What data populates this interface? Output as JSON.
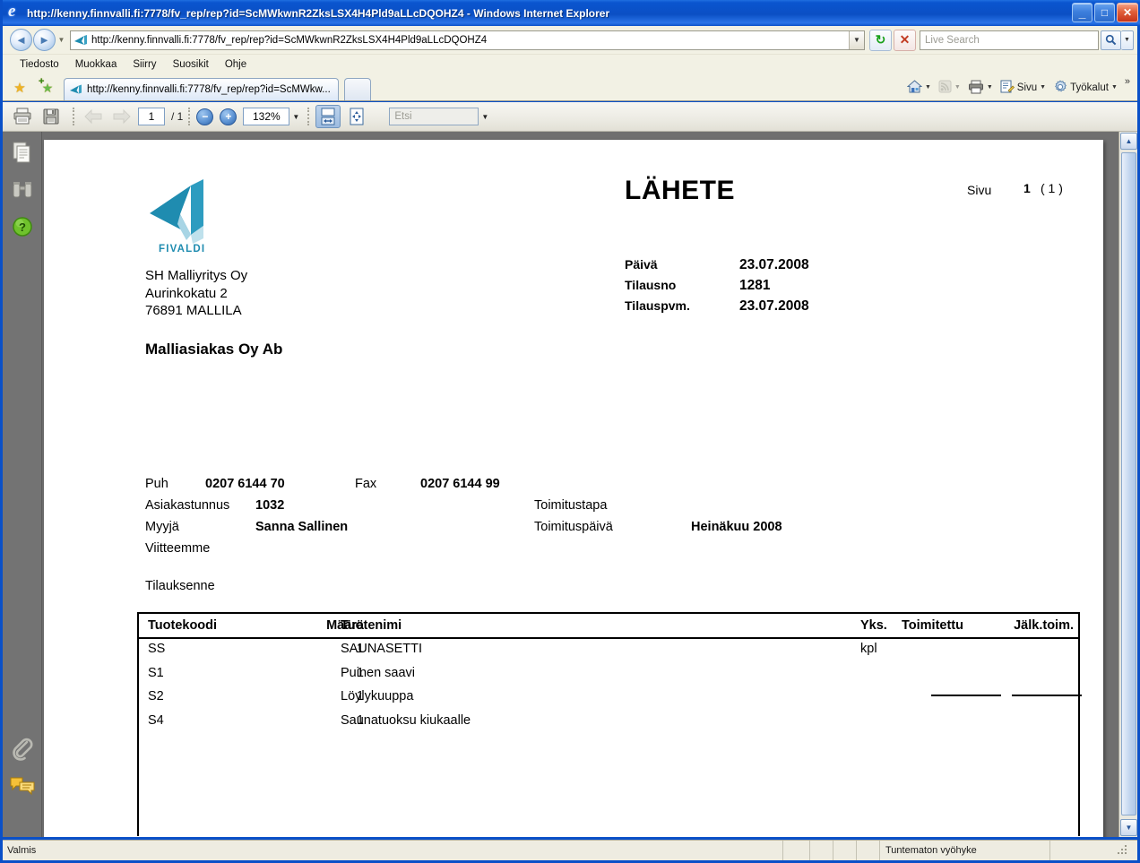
{
  "window": {
    "title": "http://kenny.finnvalli.fi:7778/fv_rep/rep?id=ScMWkwnR2ZksLSX4H4Pld9aLLcDQOHZ4 - Windows Internet Explorer",
    "minimize_label": "_",
    "maximize_label": "□",
    "close_label": "✕"
  },
  "address_bar": {
    "url": "http://kenny.finnvalli.fi:7778/fv_rep/rep?id=ScMWkwnR2ZksLSX4H4Pld9aLLcDQOHZ4",
    "back_label": "◄",
    "forward_label": "►",
    "refresh_label": "↻",
    "stop_label": "✕",
    "search_placeholder": "Live Search",
    "search_icon": "search-icon",
    "dropdown_caret": "▼"
  },
  "menubar": {
    "items": [
      {
        "label": "Tiedosto"
      },
      {
        "label": "Muokkaa"
      },
      {
        "label": "Siirry"
      },
      {
        "label": "Suosikit"
      },
      {
        "label": "Ohje"
      }
    ]
  },
  "tabs": {
    "favorites_label": "★",
    "add_favorite_label": "★",
    "items": [
      {
        "label": "http://kenny.finnvalli.fi:7778/fv_rep/rep?id=ScMWkw..."
      }
    ],
    "new_tab_label": "",
    "commands": [
      {
        "label": "",
        "icon": "home-icon",
        "glyph": "⌂",
        "caret": "▼",
        "disabled": false
      },
      {
        "label": "",
        "icon": "rss-feed-icon",
        "glyph": "◕",
        "caret": "▼",
        "disabled": true
      },
      {
        "label": "",
        "icon": "print-icon",
        "glyph": "⎙",
        "caret": "▼",
        "disabled": false
      },
      {
        "label": "Sivu",
        "icon": "page-icon",
        "glyph": "▤",
        "caret": "▼",
        "disabled": false
      },
      {
        "label": "Työkalut",
        "icon": "gear-icon",
        "glyph": "✷",
        "caret": "▼",
        "disabled": false
      }
    ],
    "overflow_label": "»"
  },
  "pdf_toolbar": {
    "print_label": "⎙",
    "save_label": "▤",
    "prev_page_label": "◄",
    "next_page_label": "►",
    "current_page": "1",
    "page_total": "/ 1",
    "zoom_out_label": "−",
    "zoom_in_label": "+",
    "zoom_level": "132%",
    "zoom_caret": "▼",
    "fit_width_label": "↔",
    "fit_page_label": "✥",
    "find_placeholder": "Etsi",
    "find_caret": "▼"
  },
  "nav_pane": {
    "items": [
      {
        "name": "pages-panel-icon",
        "label": ""
      },
      {
        "name": "search-binoculars-icon",
        "label": ""
      },
      {
        "name": "help-icon",
        "label": "?"
      },
      {
        "name": "attachments-paperclip-icon",
        "label": ""
      },
      {
        "name": "comments-icon",
        "label": ""
      }
    ]
  },
  "scrollbar": {
    "up_label": "▲",
    "down_label": "▼"
  },
  "statusbar": {
    "status_text": "Valmis",
    "zone_text": "Tuntematon vyöhyke"
  },
  "document": {
    "logo_text": "FIVALDI",
    "logo_color_dark": "#1f8cb0",
    "logo_color_light": "#a8d5e5",
    "sender": {
      "company": "SH Malliyritys Oy",
      "street": "Aurinkokatu 2",
      "city": "76891 MALLILA"
    },
    "customer": "Malliasiakas Oy Ab",
    "title": "LÄHETE",
    "page_label": "Sivu",
    "page_number": "1",
    "page_total": "( 1 )",
    "meta": [
      {
        "key": "Päivä",
        "value": "23.07.2008"
      },
      {
        "key": "Tilausno",
        "value": "1281"
      },
      {
        "key": "Tilauspvm.",
        "value": "23.07.2008"
      }
    ],
    "contact_row": {
      "phone_label": "Puh",
      "phone_value": "0207 6144 70",
      "fax_label": "Fax",
      "fax_value": "0207 6144 99"
    },
    "detail_rows": [
      {
        "label": "Asiakastunnus",
        "value": "1032",
        "label2": "Toimitustapa",
        "value2": ""
      },
      {
        "label": "Myyjä",
        "value": "Sanna Sallinen",
        "label2": "Toimituspäivä",
        "value2": "Heinäkuu 2008"
      },
      {
        "label": "Viitteemme",
        "value": "",
        "label2": "",
        "value2": ""
      }
    ],
    "your_order_label": "Tilauksenne",
    "table": {
      "headers": {
        "code": "Tuotekoodi",
        "name": "Tuotenimi",
        "qty": "Määrä",
        "unit": "Yks.",
        "delivered": "Toimitettu",
        "backorder": "Jälk.toim."
      },
      "rows": [
        {
          "code": "SS",
          "name": "SAUNASETTI",
          "qty": "1",
          "unit": "kpl",
          "delivered": "",
          "backorder": ""
        },
        {
          "code": "S1",
          "name": "Puinen saavi",
          "qty": "1",
          "unit": "",
          "delivered": "",
          "backorder": ""
        },
        {
          "code": "S2",
          "name": "Löylykuuppa",
          "qty": "1",
          "unit": "",
          "delivered": "",
          "backorder": ""
        },
        {
          "code": "S4",
          "name": "Saunatuoksu kiukaalle",
          "qty": "1",
          "unit": "",
          "delivered": "",
          "backorder": ""
        }
      ]
    }
  }
}
